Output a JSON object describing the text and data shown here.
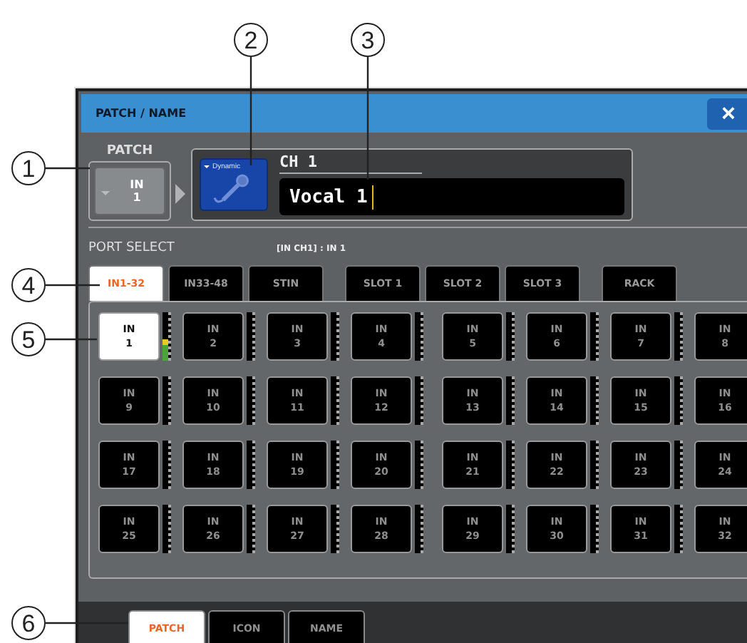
{
  "callouts": [
    "1",
    "2",
    "3",
    "4",
    "5",
    "6"
  ],
  "window": {
    "title": "PATCH / NAME",
    "close": "×"
  },
  "patch": {
    "label": "PATCH",
    "line1": "IN",
    "line2": "1"
  },
  "channel": {
    "icon_label": "Dynamic",
    "channel": "CH 1",
    "name": "Vocal 1"
  },
  "port_select": {
    "label": "PORT SELECT",
    "current": "[IN CH1] : IN 1"
  },
  "port_tab_groups": [
    [
      {
        "label": "IN1-32",
        "selected": true
      },
      {
        "label": "IN33-48",
        "selected": false
      },
      {
        "label": "STIN",
        "selected": false
      }
    ],
    [
      {
        "label": "SLOT 1",
        "selected": false
      },
      {
        "label": "SLOT 2",
        "selected": false
      },
      {
        "label": "SLOT 3",
        "selected": false
      }
    ],
    [
      {
        "label": "RACK",
        "selected": false
      }
    ]
  ],
  "ports": [
    {
      "label": "IN",
      "number": "1",
      "selected": true,
      "level": 0.45
    },
    {
      "label": "IN",
      "number": "2",
      "selected": false
    },
    {
      "label": "IN",
      "number": "3",
      "selected": false
    },
    {
      "label": "IN",
      "number": "4",
      "selected": false
    },
    {
      "label": "IN",
      "number": "5",
      "selected": false
    },
    {
      "label": "IN",
      "number": "6",
      "selected": false
    },
    {
      "label": "IN",
      "number": "7",
      "selected": false
    },
    {
      "label": "IN",
      "number": "8",
      "selected": false
    },
    {
      "label": "IN",
      "number": "9",
      "selected": false
    },
    {
      "label": "IN",
      "number": "10",
      "selected": false
    },
    {
      "label": "IN",
      "number": "11",
      "selected": false
    },
    {
      "label": "IN",
      "number": "12",
      "selected": false
    },
    {
      "label": "IN",
      "number": "13",
      "selected": false
    },
    {
      "label": "IN",
      "number": "14",
      "selected": false
    },
    {
      "label": "IN",
      "number": "15",
      "selected": false
    },
    {
      "label": "IN",
      "number": "16",
      "selected": false
    },
    {
      "label": "IN",
      "number": "17",
      "selected": false
    },
    {
      "label": "IN",
      "number": "18",
      "selected": false
    },
    {
      "label": "IN",
      "number": "19",
      "selected": false
    },
    {
      "label": "IN",
      "number": "20",
      "selected": false
    },
    {
      "label": "IN",
      "number": "21",
      "selected": false
    },
    {
      "label": "IN",
      "number": "22",
      "selected": false
    },
    {
      "label": "IN",
      "number": "23",
      "selected": false
    },
    {
      "label": "IN",
      "number": "24",
      "selected": false
    },
    {
      "label": "IN",
      "number": "25",
      "selected": false
    },
    {
      "label": "IN",
      "number": "26",
      "selected": false
    },
    {
      "label": "IN",
      "number": "27",
      "selected": false
    },
    {
      "label": "IN",
      "number": "28",
      "selected": false
    },
    {
      "label": "IN",
      "number": "29",
      "selected": false
    },
    {
      "label": "IN",
      "number": "30",
      "selected": false
    },
    {
      "label": "IN",
      "number": "31",
      "selected": false
    },
    {
      "label": "IN",
      "number": "32",
      "selected": false
    }
  ],
  "bottom_tabs": [
    {
      "label": "PATCH",
      "selected": true
    },
    {
      "label": "ICON",
      "selected": false
    },
    {
      "label": "NAME",
      "selected": false
    }
  ]
}
